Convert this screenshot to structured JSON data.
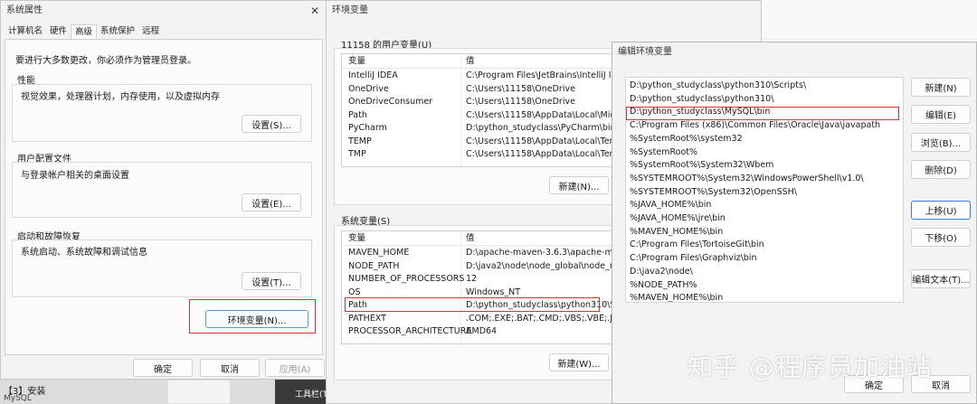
{
  "sys_props": {
    "title": "系统属性",
    "tabs": [
      "计算机名",
      "硬件",
      "高级",
      "系统保护",
      "远程"
    ],
    "notice": "要进行大多数更改，你必须作为管理员登录。",
    "performance": {
      "title": "性能",
      "desc": "视觉效果，处理器计划，内存使用，以及虚拟内存",
      "button": "设置(S)..."
    },
    "profile": {
      "title": "用户配置文件",
      "desc": "与登录帐户相关的桌面设置",
      "button": "设置(E)..."
    },
    "startup": {
      "title": "启动和故障恢复",
      "desc": "系统启动、系统故障和调试信息",
      "button": "设置(T)..."
    },
    "env_button": "环境变量(N)...",
    "ok": "确定",
    "cancel": "取消",
    "apply": "应用(A)"
  },
  "env_vars": {
    "title": "环境变量",
    "user_section": "11158 的用户变量(U)",
    "sys_section": "系统变量(S)",
    "col_var": "变量",
    "col_val": "值",
    "user_rows": [
      {
        "name": "IntelliJ IDEA",
        "value": "C:\\Program Files\\JetBrains\\IntelliJ IDE"
      },
      {
        "name": "OneDrive",
        "value": "C:\\Users\\11158\\OneDrive"
      },
      {
        "name": "OneDriveConsumer",
        "value": "C:\\Users\\11158\\OneDrive"
      },
      {
        "name": "Path",
        "value": "C:\\Users\\11158\\AppData\\Local\\Micr"
      },
      {
        "name": "PyCharm",
        "value": "D:\\python_studyclass\\PyCharm\\bin;"
      },
      {
        "name": "TEMP",
        "value": "C:\\Users\\11158\\AppData\\Local\\Tem"
      },
      {
        "name": "TMP",
        "value": "C:\\Users\\11158\\AppData\\Local\\Tem"
      }
    ],
    "user_new": "新建(N)...",
    "sys_rows": [
      {
        "name": "MAVEN_HOME",
        "value": "D:\\apache-maven-3.6.3\\apache-mave"
      },
      {
        "name": "NODE_PATH",
        "value": "D:\\java2\\node\\node_global\\node_m"
      },
      {
        "name": "NUMBER_OF_PROCESSORS",
        "value": "12"
      },
      {
        "name": "OS",
        "value": "Windows_NT"
      },
      {
        "name": "Path",
        "value": "D:\\python_studyclass\\python310\\Sc"
      },
      {
        "name": "PATHEXT",
        "value": ".COM;.EXE;.BAT;.CMD;.VBS;.VBE;.JS;.J"
      },
      {
        "name": "PROCESSOR_ARCHITECTURE",
        "value": "AMD64"
      }
    ],
    "sys_new": "新建(W)..."
  },
  "edit_env": {
    "title": "编辑环境变量",
    "paths": [
      "D:\\python_studyclass\\python310\\Scripts\\",
      "D:\\python_studyclass\\python310\\",
      "D:\\python_studyclass\\MySQL\\bin",
      "C:\\Program Files (x86)\\Common Files\\Oracle\\Java\\javapath",
      "%SystemRoot%\\system32",
      "%SystemRoot%",
      "%SystemRoot%\\System32\\Wbem",
      "%SYSTEMROOT%\\System32\\WindowsPowerShell\\v1.0\\",
      "%SYSTEMROOT%\\System32\\OpenSSH\\",
      "%JAVA_HOME%\\bin",
      "%JAVA_HOME%\\jre\\bin",
      "%MAVEN_HOME%\\bin",
      "C:\\Program Files\\TortoiseGit\\bin",
      "C:\\Program Files\\Graphviz\\bin",
      "D:\\java2\\node\\",
      "%NODE_PATH%",
      "%MAVEN_HOME%\\bin"
    ],
    "buttons": {
      "new": "新建(N)",
      "edit": "编辑(E)",
      "browse": "浏览(B)...",
      "delete": "删除(D)",
      "up": "上移(U)",
      "down": "下移(O)",
      "edit_text": "编辑文本(T)..."
    },
    "ok": "确定",
    "cancel": "取消"
  },
  "background": {
    "step_label": "【3】安装",
    "sub_label": "MySQL",
    "toolbar": "工具栏(T)"
  },
  "watermark": "知乎 @程序员加油站",
  "colors": {
    "highlight": "#d6333b",
    "accent": "#3b7ddd",
    "dialog_bg": "#f3f3f3"
  }
}
